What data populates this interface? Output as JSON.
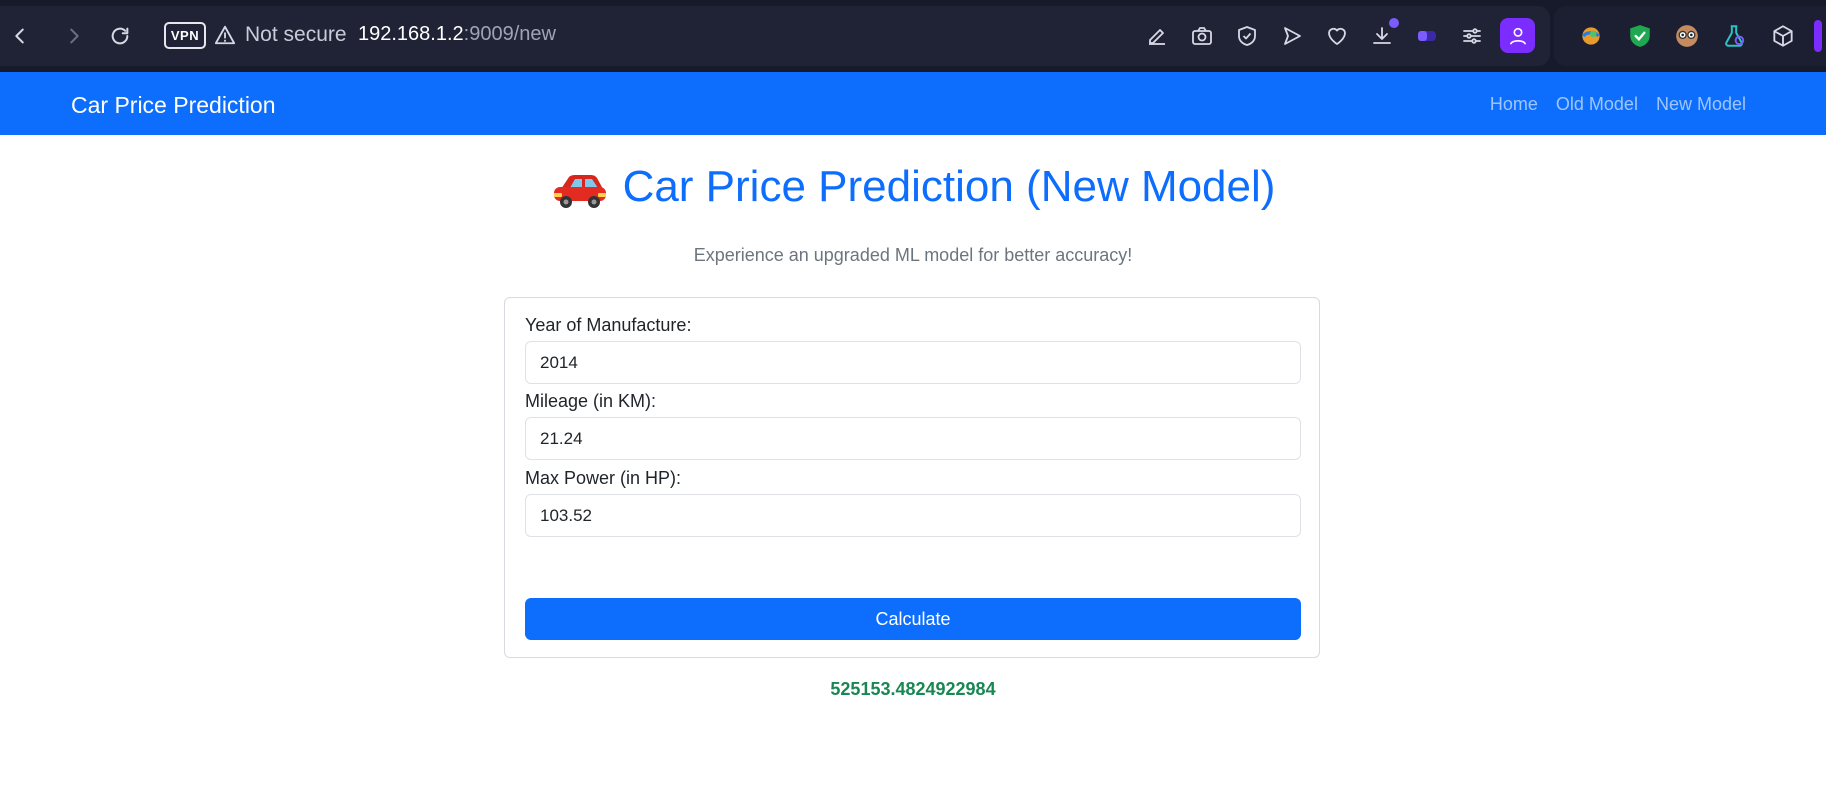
{
  "browser": {
    "vpn_label": "VPN",
    "security_label": "Not secure",
    "url_host": "192.168.1.2",
    "url_rest": ":9009/new"
  },
  "navbar": {
    "brand": "Car Price Prediction",
    "links": [
      "Home",
      "Old Model",
      "New Model"
    ]
  },
  "page": {
    "title": "Car Price Prediction (New Model)",
    "subtitle": "Experience an upgraded ML model for better accuracy!"
  },
  "form": {
    "year_label": "Year of Manufacture:",
    "year_value": "2014",
    "mileage_label": "Mileage (in KM):",
    "mileage_value": "21.24",
    "power_label": "Max Power (in HP):",
    "power_value": "103.52",
    "button_label": "Calculate"
  },
  "result": "525153.4824922984",
  "colors": {
    "primary": "#0d6efd",
    "success": "#198754",
    "browser_bg": "#161a2b"
  }
}
